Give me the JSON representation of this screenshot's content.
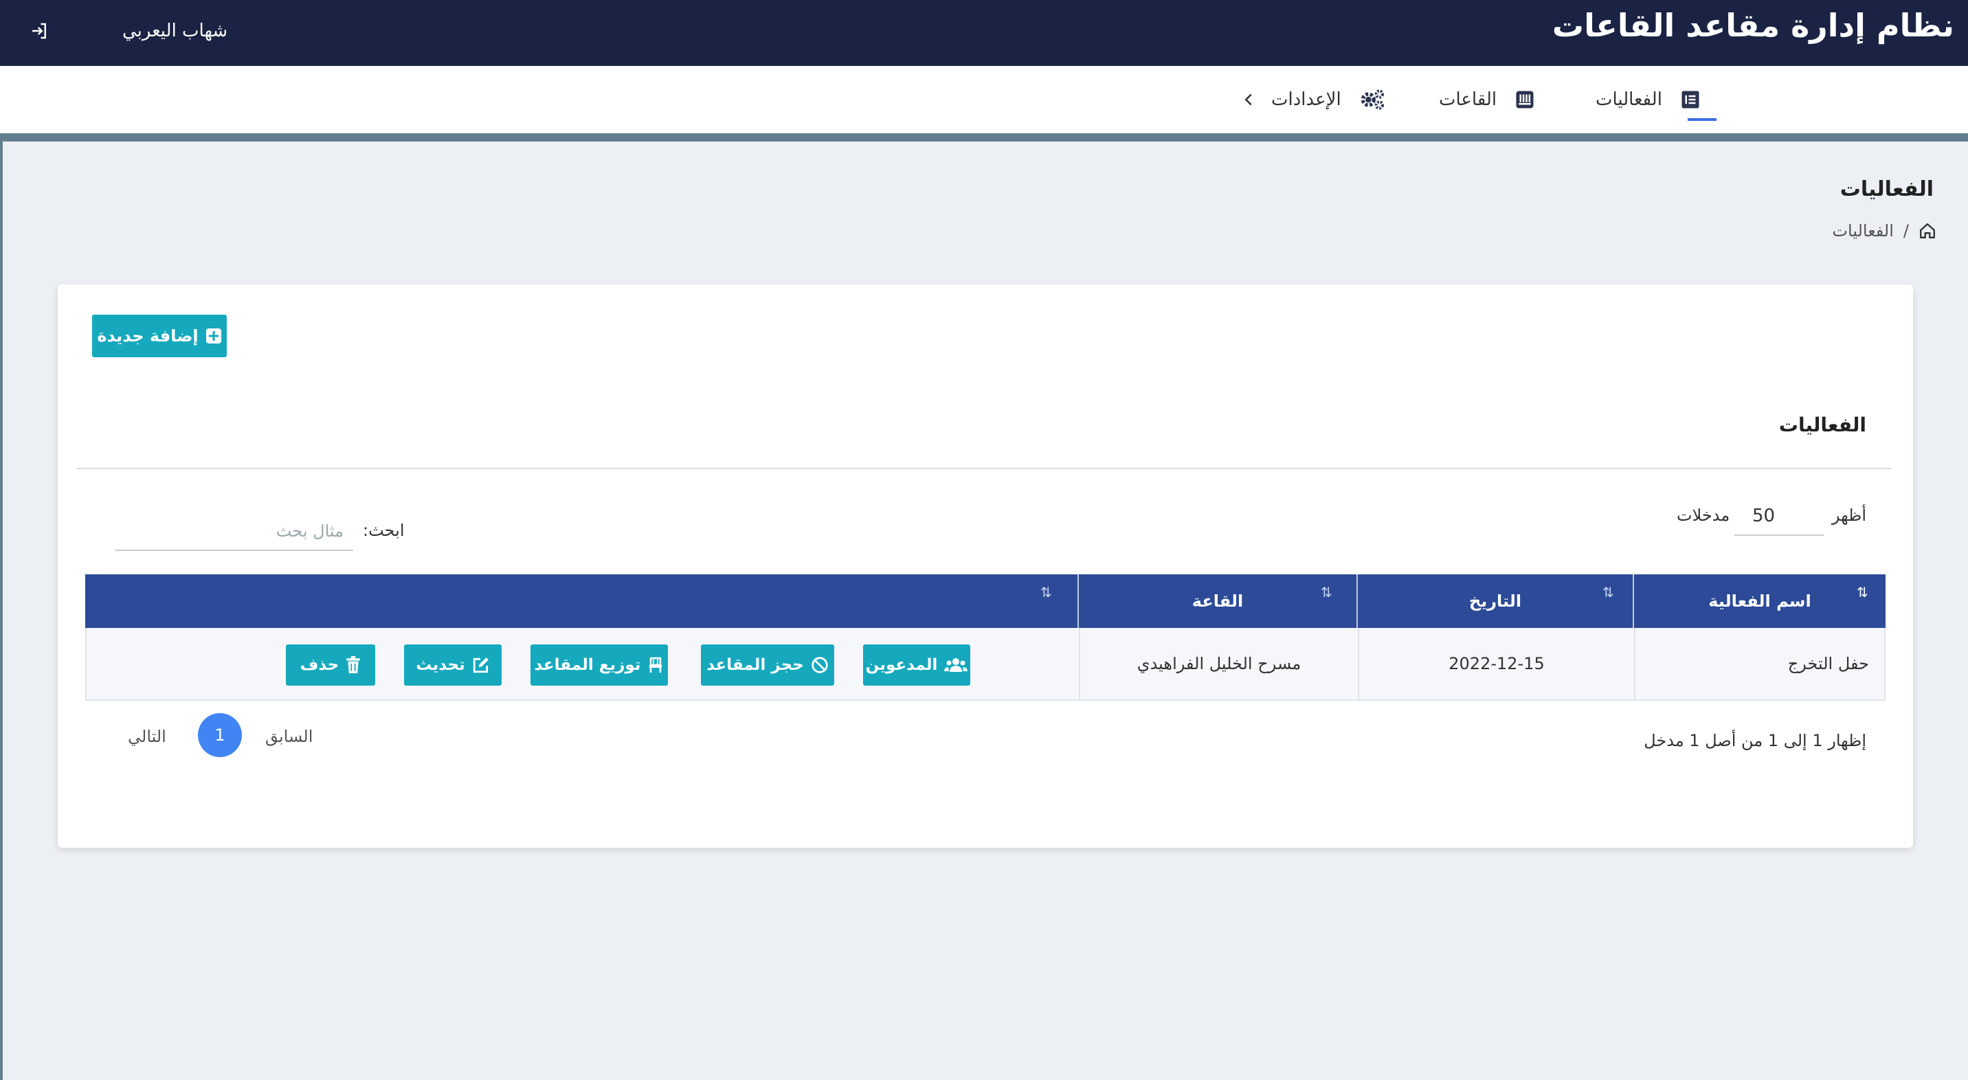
{
  "header": {
    "app_title": "نظام إدارة مقاعد القاعات",
    "user_name": "شهاب اليعربي"
  },
  "nav": {
    "items": [
      {
        "label": "الفعاليات",
        "icon": "events-list-icon",
        "active": true
      },
      {
        "label": "القاعات",
        "icon": "halls-icon",
        "active": false
      },
      {
        "label": "الإعدادات",
        "icon": "gears-icon",
        "active": false
      }
    ]
  },
  "page": {
    "heading": "الفعاليات",
    "breadcrumb": {
      "home_icon": "home-icon",
      "separator": "/",
      "current": "الفعاليات"
    }
  },
  "card": {
    "add_button": "إضافة جديدة",
    "title": "الفعاليات",
    "length": {
      "show_label": "أظهر",
      "value": "50",
      "entries_label": "مدخلات"
    },
    "search": {
      "label": "ابحث:",
      "placeholder": "مثال بحث"
    },
    "table": {
      "columns": [
        "اسم الفعالية",
        "التاريخ",
        "القاعة",
        ""
      ],
      "rows": [
        {
          "event_name": "حفل التخرج",
          "date": "2022-12-15",
          "hall": "مسرح الخليل الفراهيدي"
        }
      ],
      "row_actions": [
        {
          "label": "المدعوين",
          "icon": "users-icon"
        },
        {
          "label": "حجز المقاعد",
          "icon": "ban-icon"
        },
        {
          "label": "توزيع المقاعد",
          "icon": "chair-icon"
        },
        {
          "label": "تحديث",
          "icon": "edit-icon"
        },
        {
          "label": "حذف",
          "icon": "trash-icon"
        }
      ]
    },
    "info": "إظهار 1 إلى 1 من أصل 1 مدخل",
    "pagination": {
      "previous": "السابق",
      "current": "1",
      "next": "التالي"
    }
  },
  "colors": {
    "topbar": "#1a2343",
    "accent": "#16a9bd",
    "table_header": "#2c4a97",
    "page_active": "#4184f3"
  }
}
